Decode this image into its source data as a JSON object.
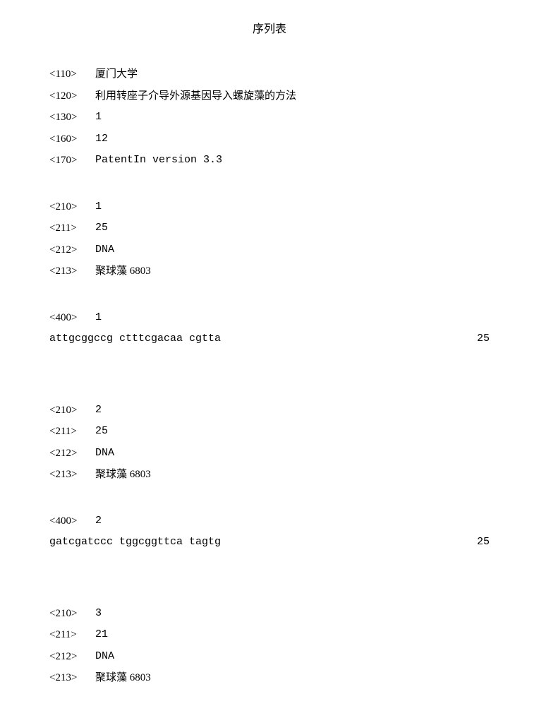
{
  "title": "序列表",
  "header": {
    "t110": "<110>",
    "v110": "厦门大学",
    "t120": "<120>",
    "v120": "利用转座子介导外源基因导入螺旋藻的方法",
    "t130": "<130>",
    "v130": "1",
    "t160": "<160>",
    "v160": "12",
    "t170": "<170>",
    "v170": "PatentIn version 3.3"
  },
  "seq1": {
    "t210": "<210>",
    "v210": "1",
    "t211": "<211>",
    "v211": "25",
    "t212": "<212>",
    "v212": "DNA",
    "t213": "<213>",
    "v213": "聚球藻 6803",
    "t400": "<400>",
    "v400": "1",
    "sequence": "attgcggccg ctttcgacaa cgtta",
    "length": "25"
  },
  "seq2": {
    "t210": "<210>",
    "v210": "2",
    "t211": "<211>",
    "v211": "25",
    "t212": "<212>",
    "v212": "DNA",
    "t213": "<213>",
    "v213": "聚球藻 6803",
    "t400": "<400>",
    "v400": "2",
    "sequence": "gatcgatccc tggcggttca tagtg",
    "length": "25"
  },
  "seq3": {
    "t210": "<210>",
    "v210": "3",
    "t211": "<211>",
    "v211": "21",
    "t212": "<212>",
    "v212": "DNA",
    "t213": "<213>",
    "v213": "聚球藻 6803"
  }
}
